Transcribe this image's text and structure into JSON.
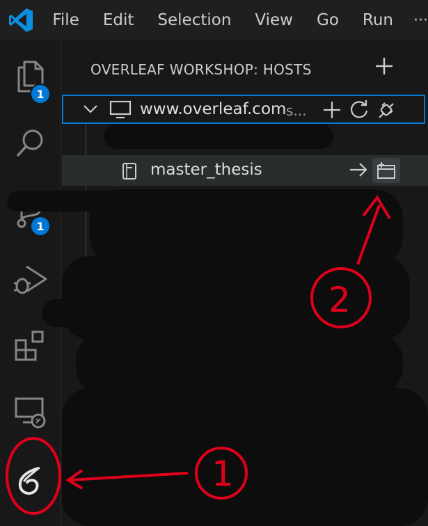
{
  "menubar": {
    "items": [
      "File",
      "Edit",
      "Selection",
      "View",
      "Go",
      "Run"
    ],
    "more": "···"
  },
  "activity": {
    "explorer_badge": "1",
    "scm_badge": "1"
  },
  "panel": {
    "title": "OVERLEAF WORKSHOP: HOSTS",
    "host": {
      "label": "www.overleaf.com",
      "description": "s..."
    },
    "selected_project": "master_thesis"
  },
  "annotations": {
    "one": "1",
    "two": "2"
  },
  "colors": {
    "accent": "#0078d4",
    "annotation": "#e0001b"
  }
}
